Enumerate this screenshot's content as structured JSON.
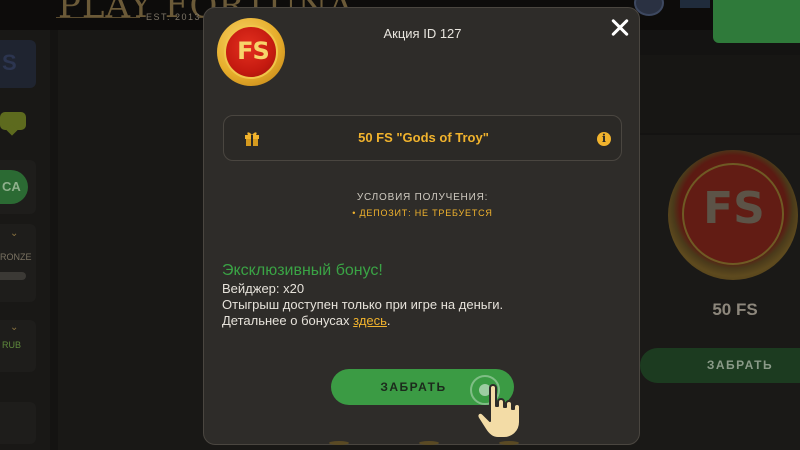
{
  "background": {
    "brand": "PLAY FORTUNA",
    "brand_est": "EST. 2013",
    "sidebar": {
      "pill_text": "CA",
      "level_text": "RONZE",
      "currency_text": "RUB"
    },
    "promo_card": {
      "coin_text": "FS",
      "label": "50 FS",
      "claim_label": "ЗАБРАТЬ"
    }
  },
  "modal": {
    "coin_text": "FS",
    "title": "Акция ID 127",
    "bonus": {
      "name": "50 FS \"Gods of Troy\"",
      "gift_icon": "gift-icon",
      "info_icon": "info-icon",
      "info_glyph": "i"
    },
    "conditions": {
      "title": "УСЛОВИЯ ПОЛУЧЕНИЯ:",
      "items": [
        "• ДЕПОЗИТ: НЕ ТРЕБУЕТСЯ"
      ]
    },
    "exclusive_title": "Эксклюзивный бонус!",
    "wager": "Вейджер: x20",
    "winnings_note": "Отыгрыш доступен только при игре на деньги.",
    "more_text": "Детальнее о бонусах ",
    "more_link": "здесь",
    "more_suffix": ".",
    "claim_label": "ЗАБРАТЬ",
    "close_icon": "close-icon"
  },
  "colors": {
    "accent": "#f1b32d",
    "success": "#3b9b44",
    "modal_bg": "#2e2c29",
    "page_bg": "#141312"
  }
}
